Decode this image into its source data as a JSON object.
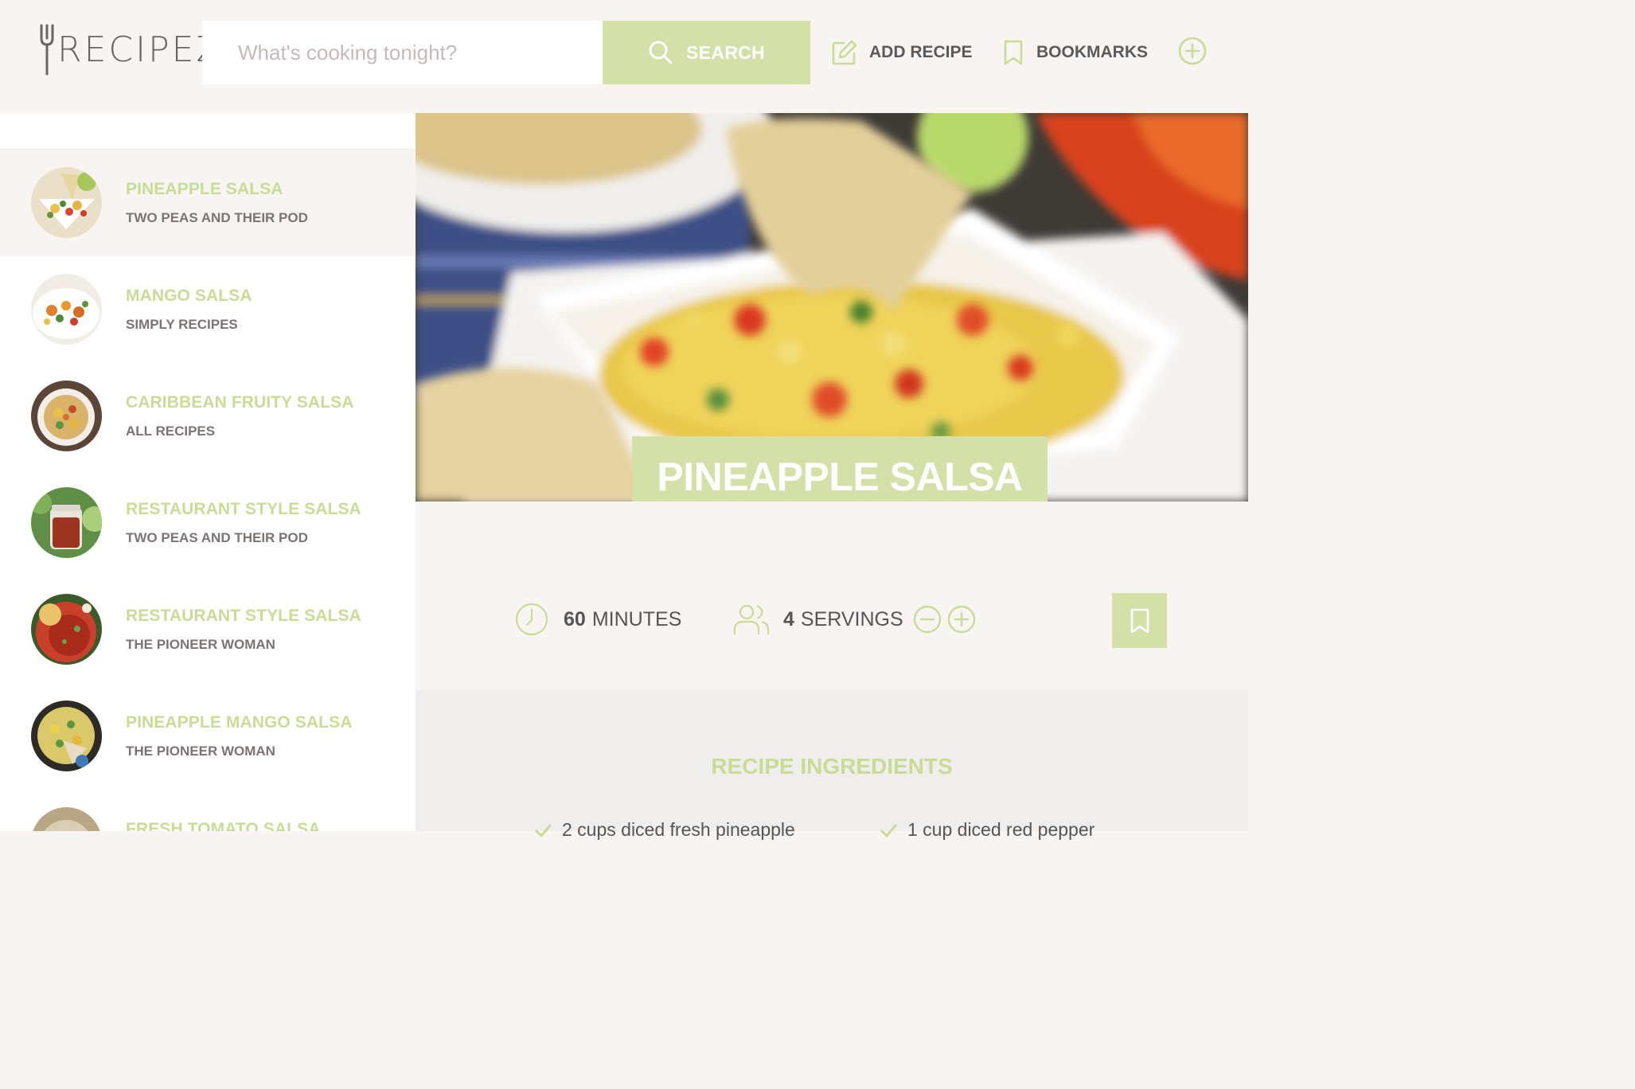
{
  "header": {
    "logo_text": "RECIPEZ",
    "search_placeholder": "What's cooking tonight?",
    "search_label": "SEARCH",
    "add_recipe_label": "ADD RECIPE",
    "bookmarks_label": "BOOKMARKS"
  },
  "sidebar": {
    "results": [
      {
        "title": "PINEAPPLE SALSA",
        "author": "TWO PEAS AND THEIR POD",
        "active": true
      },
      {
        "title": "MANGO SALSA",
        "author": "SIMPLY RECIPES"
      },
      {
        "title": "CARIBBEAN FRUITY SALSA",
        "author": "ALL RECIPES"
      },
      {
        "title": "RESTAURANT STYLE SALSA",
        "author": "TWO PEAS AND THEIR POD"
      },
      {
        "title": "RESTAURANT STYLE SALSA",
        "author": "THE PIONEER WOMAN"
      },
      {
        "title": "PINEAPPLE MANGO SALSA",
        "author": "THE PIONEER WOMAN"
      },
      {
        "title": "FRESH TOMATO SALSA",
        "author": ""
      }
    ]
  },
  "recipe": {
    "title": "PINEAPPLE SALSA",
    "time_value": "60",
    "time_unit": "MINUTES",
    "servings_value": "4",
    "servings_unit": "SERVINGS",
    "ingredients_heading": "RECIPE INGREDIENTS",
    "ingredients": [
      "2 cups diced fresh pineapple",
      "1 cup diced red pepper"
    ]
  },
  "colors": {
    "accent": "#d3e1a9",
    "accent_text": "#c9dc95",
    "background": "#f7f4f2",
    "text": "#555555",
    "muted": "#7d7373"
  },
  "icons": [
    "fork-logo-icon",
    "search-icon",
    "edit-icon",
    "bookmark-icon",
    "plus-circle-icon",
    "clock-icon",
    "users-icon",
    "minus-circle-icon",
    "check-icon"
  ]
}
